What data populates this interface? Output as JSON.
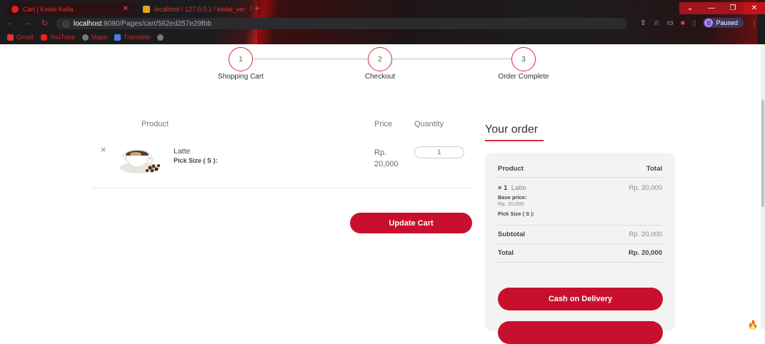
{
  "browser": {
    "tabs": [
      {
        "title": "Cart | Kedai Kafia",
        "active": true
      },
      {
        "title": "localhost / 127.0.0.1 / kedai_ver",
        "active": false
      }
    ],
    "url_host": "localhost",
    "url_path": ":8080/Pages/cart/562ed257e29fbb",
    "bookmarks": [
      "Gmail",
      "YouTube",
      "Maps",
      "Translate"
    ],
    "profile_initial": "B",
    "profile_status": "Paused"
  },
  "steps": [
    {
      "number": "1",
      "label": "Shopping Cart"
    },
    {
      "number": "2",
      "label": "Checkout"
    },
    {
      "number": "3",
      "label": "Order Complete"
    }
  ],
  "cart": {
    "headers": {
      "product": "Product",
      "price": "Price",
      "quantity": "Quantity"
    },
    "item": {
      "remove_symbol": "×",
      "name": "Latte",
      "option": "Pick Size ( S ):",
      "price_line1": "Rp.",
      "price_line2": "20,000",
      "quantity": "1"
    },
    "update_label": "Update Cart"
  },
  "order": {
    "title": "Your order",
    "col_product": "Product",
    "col_total": "Total",
    "item_qty": "× 1",
    "item_name": "Latte",
    "item_total": "Rp. 20,000",
    "base_price_label": "Base price:",
    "base_price_value": "Rp. 20,000",
    "item_option": "Pick Size ( S ):",
    "subtotal_label": "Subtotal",
    "subtotal_value": "Rp. 20,000",
    "total_label": "Total",
    "total_value": "Rp. 20,000",
    "cod_label": "Cash on Delivery"
  },
  "colors": {
    "accent": "#c8102e",
    "step_ring": "#d22a3e"
  }
}
